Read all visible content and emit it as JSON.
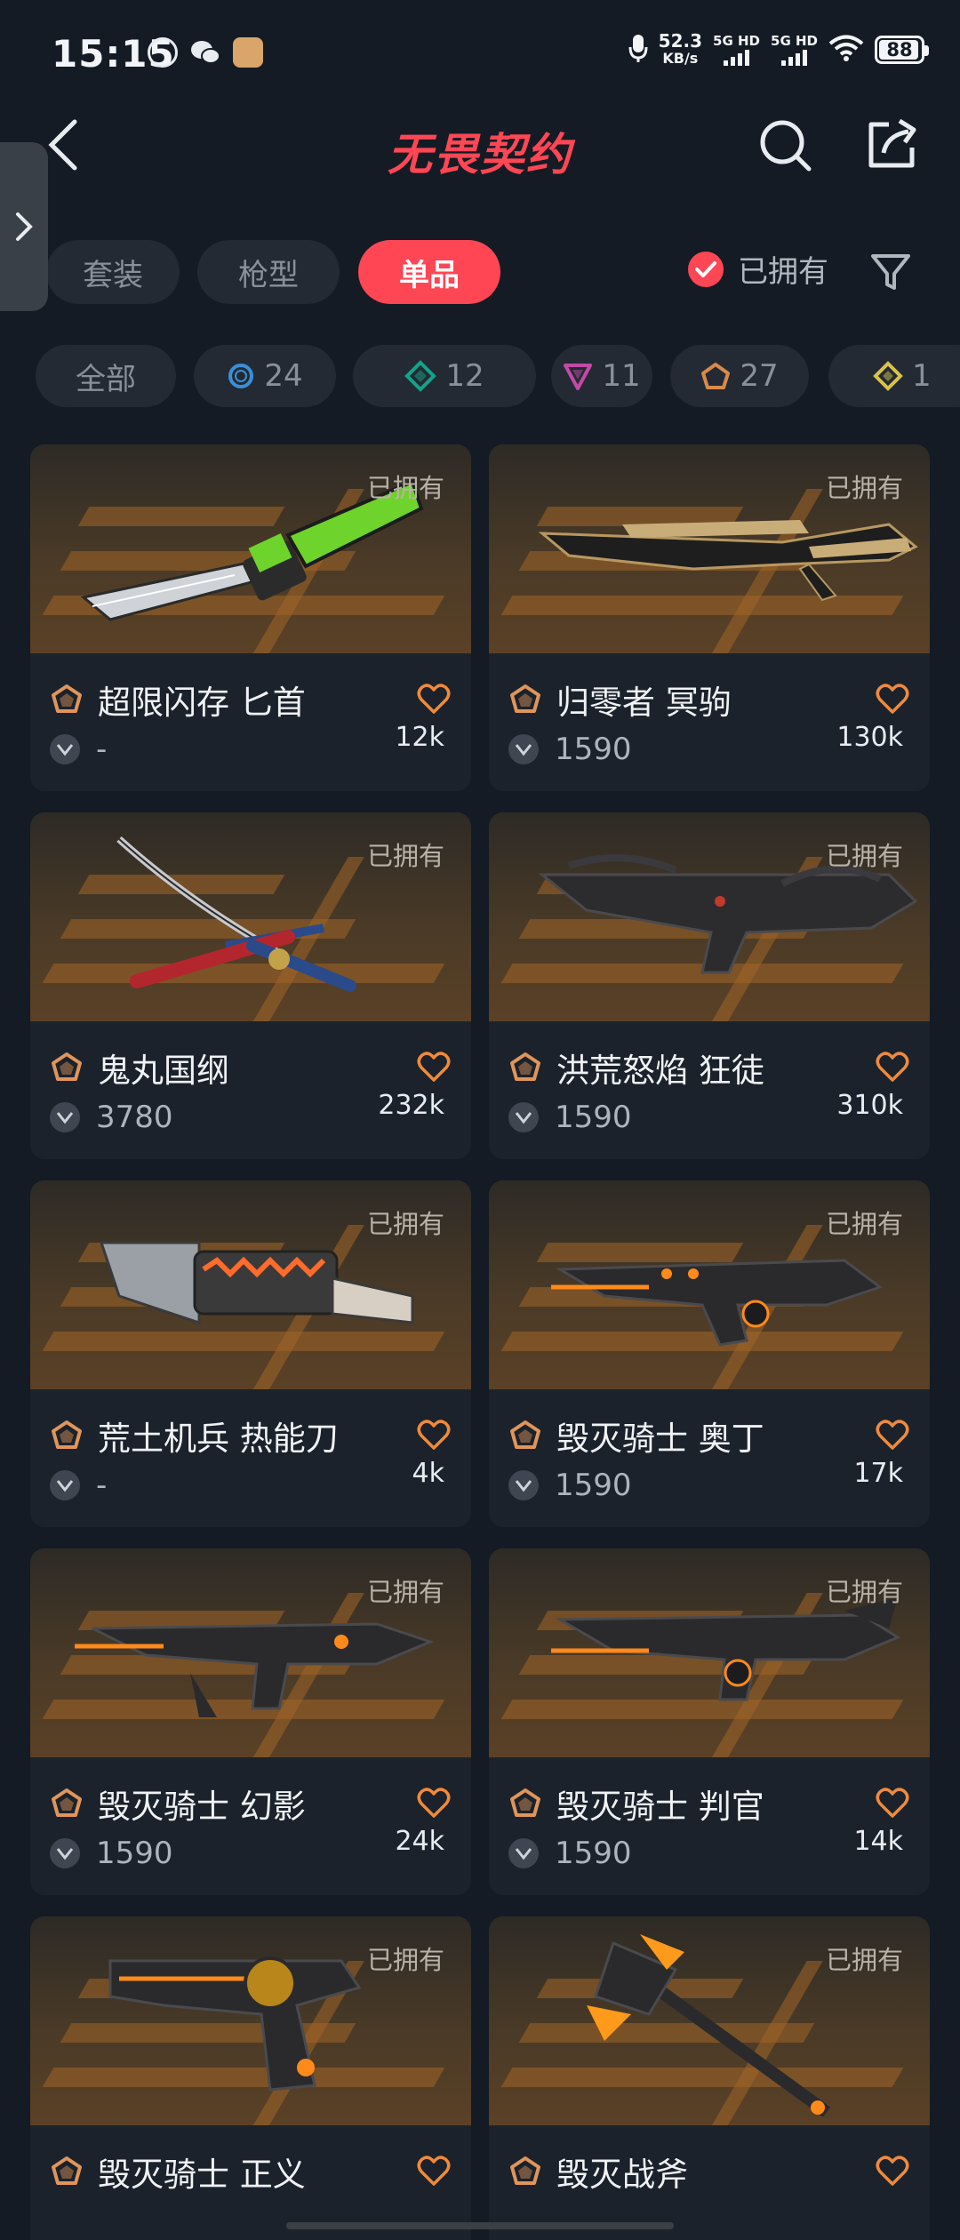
{
  "status": {
    "time": "15:15",
    "net_speed_value": "52.3",
    "net_speed_unit": "KB/s",
    "sim1_label": "5G HD",
    "sim2_label": "5G HD",
    "battery": "88"
  },
  "header": {
    "title": "无畏契约",
    "brand_color": "#ff4655"
  },
  "type_tabs": [
    {
      "label": "套装",
      "active": false
    },
    {
      "label": "枪型",
      "active": false
    },
    {
      "label": "单品",
      "active": true
    }
  ],
  "owned_filter": {
    "label": "已拥有",
    "checked": true
  },
  "rarity_chips": [
    {
      "label": "全部",
      "icon": "all"
    },
    {
      "label": "24",
      "icon": "select-tier-icon",
      "color": "#3b8fd9"
    },
    {
      "label": "12",
      "icon": "deluxe-tier-icon",
      "color": "#14a38a"
    },
    {
      "label": "11",
      "icon": "premium-tier-icon",
      "color": "#c24aa6"
    },
    {
      "label": "27",
      "icon": "exclusive-tier-icon",
      "color": "#d98a4a"
    },
    {
      "label": "1",
      "icon": "ultra-tier-icon",
      "color": "#d9c24a"
    }
  ],
  "cards": [
    {
      "name": "超限闪存 匕首",
      "price": "-",
      "likes": "12k",
      "owned": "已拥有",
      "weapon": "knife-green"
    },
    {
      "name": "归零者 冥驹",
      "price": "1590",
      "likes": "130k",
      "owned": "已拥有",
      "weapon": "sniper-gold"
    },
    {
      "name": "鬼丸国纲",
      "price": "3780",
      "likes": "232k",
      "owned": "已拥有",
      "weapon": "katana"
    },
    {
      "name": "洪荒怒焰 狂徒",
      "price": "1590",
      "likes": "310k",
      "owned": "已拥有",
      "weapon": "rifle-dark"
    },
    {
      "name": "荒土机兵 热能刀",
      "price": "-",
      "likes": "4k",
      "owned": "已拥有",
      "weapon": "heat-blade"
    },
    {
      "name": "毁灭骑士 奥丁",
      "price": "1590",
      "likes": "17k",
      "owned": "已拥有",
      "weapon": "odin-dark"
    },
    {
      "name": "毁灭骑士 幻影",
      "price": "1590",
      "likes": "24k",
      "owned": "已拥有",
      "weapon": "phantom-dark"
    },
    {
      "name": "毁灭骑士 判官",
      "price": "1590",
      "likes": "14k",
      "owned": "已拥有",
      "weapon": "judge-dark"
    },
    {
      "name": "毁灭骑士 正义",
      "price": "",
      "likes": "",
      "owned": "已拥有",
      "weapon": "revolver-dark"
    },
    {
      "name": "毁灭战斧",
      "price": "",
      "likes": "",
      "owned": "已拥有",
      "weapon": "axe-dark"
    }
  ]
}
